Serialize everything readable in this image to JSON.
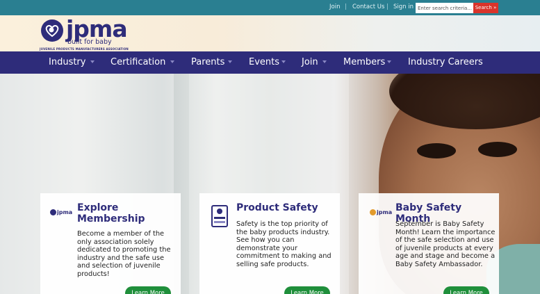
{
  "topbar": {
    "links": [
      "Join",
      "Contact Us",
      "Sign in"
    ],
    "search_placeholder": "Enter search criteria...",
    "search_button": "Search »"
  },
  "brand": {
    "name": "jpma",
    "tagline": "built for baby",
    "full_name": "JUVENILE PRODUCTS MANUFACTURERS ASSOCIATION"
  },
  "nav": {
    "items": [
      "Industry",
      "Certification",
      "Parents",
      "Events",
      "Join",
      "Members",
      "Industry Careers"
    ]
  },
  "cards": [
    {
      "title_line1": "Explore",
      "title_line2": "Membership",
      "body": "Become a member of the only association solely dedicated to promoting the industry and the safe use and selection of juvenile products!",
      "button": "Learn More",
      "logo_icon": "jpma-logo-icon"
    },
    {
      "title_line1": "Product Safety",
      "title_line2": "",
      "body": "Safety is the top priority of the baby products industry. See how you can demonstrate your commitment to making and selling safe products.",
      "button": "Learn More",
      "logo_icon": "certification-badge-icon"
    },
    {
      "title_line1": "Baby Safety Month",
      "title_line2": "",
      "body": "September is Baby Safety Month! Learn the importance of the safe selection and use of juvenile products at every age and stage and become a Baby Safety Ambassador.",
      "button": "Learn More",
      "logo_icon": "jpma-logo-icon"
    }
  ],
  "colors": {
    "topbar": "#2a7f91",
    "nav": "#2e2c7a",
    "search_button": "#d9342b",
    "card_button": "#1f8f3b"
  }
}
